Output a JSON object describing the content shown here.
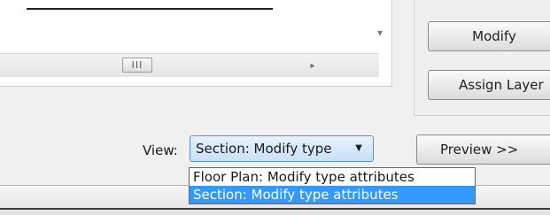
{
  "list": {
    "scroll_down_icon": "▾",
    "scroll_thumb_icon": "III",
    "scroll_right_icon": "▸"
  },
  "buttons": {
    "modify": "Modify",
    "assign_layer": "Assign Layer",
    "preview": "Preview >>"
  },
  "view": {
    "label": "View:",
    "selected": "Section: Modify type",
    "arrow_icon": "▼",
    "options": [
      "Floor Plan: Modify type attributes",
      "Section: Modify type attributes"
    ],
    "highlighted_index": 1
  },
  "colors": {
    "highlight": "#3399ff",
    "combo_border": "#5a8fc8"
  }
}
